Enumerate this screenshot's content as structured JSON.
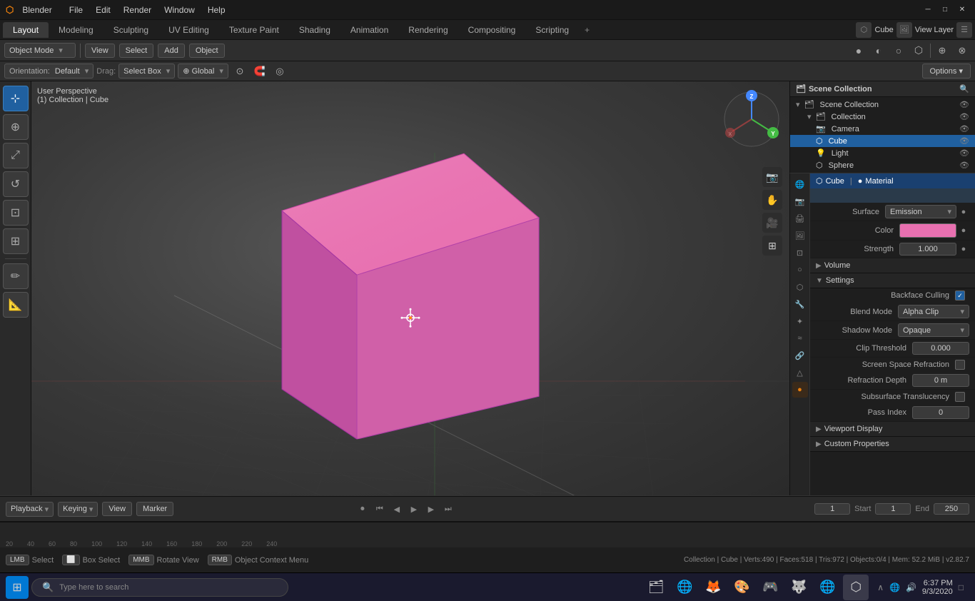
{
  "titlebar": {
    "logo": "⬡ Blender",
    "app_name": "Blender",
    "menu": [
      "File",
      "Edit",
      "Render",
      "Window",
      "Help"
    ],
    "minimize_label": "─",
    "maximize_label": "□",
    "close_label": "✕"
  },
  "workspace_tabs": {
    "tabs": [
      "Layout",
      "Modeling",
      "Sculpting",
      "UV Editing",
      "Texture Paint",
      "Shading",
      "Animation",
      "Rendering",
      "Compositing",
      "Scripting"
    ],
    "active": "Layout",
    "add_label": "+"
  },
  "toolbar2": {
    "orientation_label": "Orientation:",
    "orientation_value": "Default",
    "drag_label": "Drag:",
    "drag_value": "Select Box",
    "transform_label": "⊕ Global",
    "pivot_label": "⊙",
    "snap_label": "🧲",
    "proportional_label": "◉",
    "options_label": "Options ▾"
  },
  "header3": {
    "mode_label": "Object Mode",
    "view_label": "View",
    "select_label": "Select",
    "add_label": "Add",
    "object_label": "Object"
  },
  "viewport": {
    "perspective_label": "User Perspective",
    "breadcrumb": "(1) Collection | Cube",
    "cube_color": "#e870b0"
  },
  "tools": {
    "items": [
      "⇱",
      "↔",
      "↺",
      "⬡",
      "⊙",
      "◈",
      "✏",
      "📐"
    ]
  },
  "nav_gizmo": {
    "x_label": "X",
    "y_label": "Y",
    "z_label": "Z"
  },
  "outliner": {
    "title": "Scene Collection",
    "items": [
      {
        "name": "Scene Collection",
        "level": 0,
        "icon": "🗂",
        "type": "collection"
      },
      {
        "name": "Collection",
        "level": 1,
        "icon": "🗂",
        "type": "collection",
        "expanded": true
      },
      {
        "name": "Camera",
        "level": 2,
        "icon": "📷",
        "type": "camera"
      },
      {
        "name": "Cube",
        "level": 2,
        "icon": "⬡",
        "type": "mesh",
        "selected": true
      },
      {
        "name": "Light",
        "level": 2,
        "icon": "💡",
        "type": "light"
      },
      {
        "name": "Sphere",
        "level": 2,
        "icon": "⬡",
        "type": "mesh"
      }
    ]
  },
  "props_panel": {
    "tabs": [
      "scene",
      "render",
      "output",
      "view_layer",
      "scene2",
      "world",
      "object",
      "modifier",
      "particles",
      "physics",
      "constraints",
      "data",
      "material",
      "nodes"
    ],
    "active_tab": "material",
    "object_name": "Cube",
    "material_label": "Material",
    "header": {
      "object_label": "Cube",
      "material_label": "Material"
    },
    "surface_section": {
      "label": "Surface",
      "value": "Emission"
    },
    "color_section": {
      "label": "Color",
      "value": "#e870b0"
    },
    "strength_section": {
      "label": "Strength",
      "value": "1.000"
    },
    "volume_section": {
      "label": "Volume",
      "collapsed": true
    },
    "settings_section": {
      "label": "Settings",
      "expanded": true,
      "backface_culling": {
        "label": "Backface Culling",
        "checked": true
      },
      "blend_mode": {
        "label": "Blend Mode",
        "value": "Alpha Clip"
      },
      "shadow_mode": {
        "label": "Shadow Mode",
        "value": "Opaque"
      },
      "clip_threshold": {
        "label": "Clip Threshold",
        "value": "0.000"
      },
      "screen_space_refraction": {
        "label": "Screen Space Refraction",
        "checked": false
      },
      "refraction_depth": {
        "label": "Refraction Depth",
        "value": "0 m"
      },
      "subsurface_translucency": {
        "label": "Subsurface Translucency",
        "checked": false
      },
      "pass_index": {
        "label": "Pass Index",
        "value": "0"
      }
    },
    "viewport_display": {
      "label": "Viewport Display",
      "collapsed": true
    },
    "custom_properties": {
      "label": "Custom Properties",
      "collapsed": true
    }
  },
  "timeline": {
    "playback_label": "Playback",
    "keying_label": "Keying",
    "view_label": "View",
    "marker_label": "Marker",
    "current_frame": "1",
    "start_label": "Start",
    "start_value": "1",
    "end_label": "End",
    "end_value": "250"
  },
  "statusbar": {
    "select_key": "Select",
    "select_key2": "Box Select",
    "rotate_key": "Rotate View",
    "context_menu": "Object Context Menu",
    "stats": "Collection | Cube | Verts:490 | Faces:518 | Tris:972 | Objects:0/4 | Mem: 52.2 MiB | v2.82.7"
  },
  "taskbar": {
    "start_icon": "⊞",
    "search_placeholder": "Type here to search",
    "search_icon": "🔍",
    "app_icons": [
      "🌐",
      "📁",
      "🔥",
      "🎨",
      "🎮",
      "🐺",
      "🌐",
      "🎯"
    ],
    "time": "6:37 PM",
    "date": "9/3/2020",
    "tray_icons": [
      "🔔",
      "🔊",
      "🌐"
    ]
  }
}
